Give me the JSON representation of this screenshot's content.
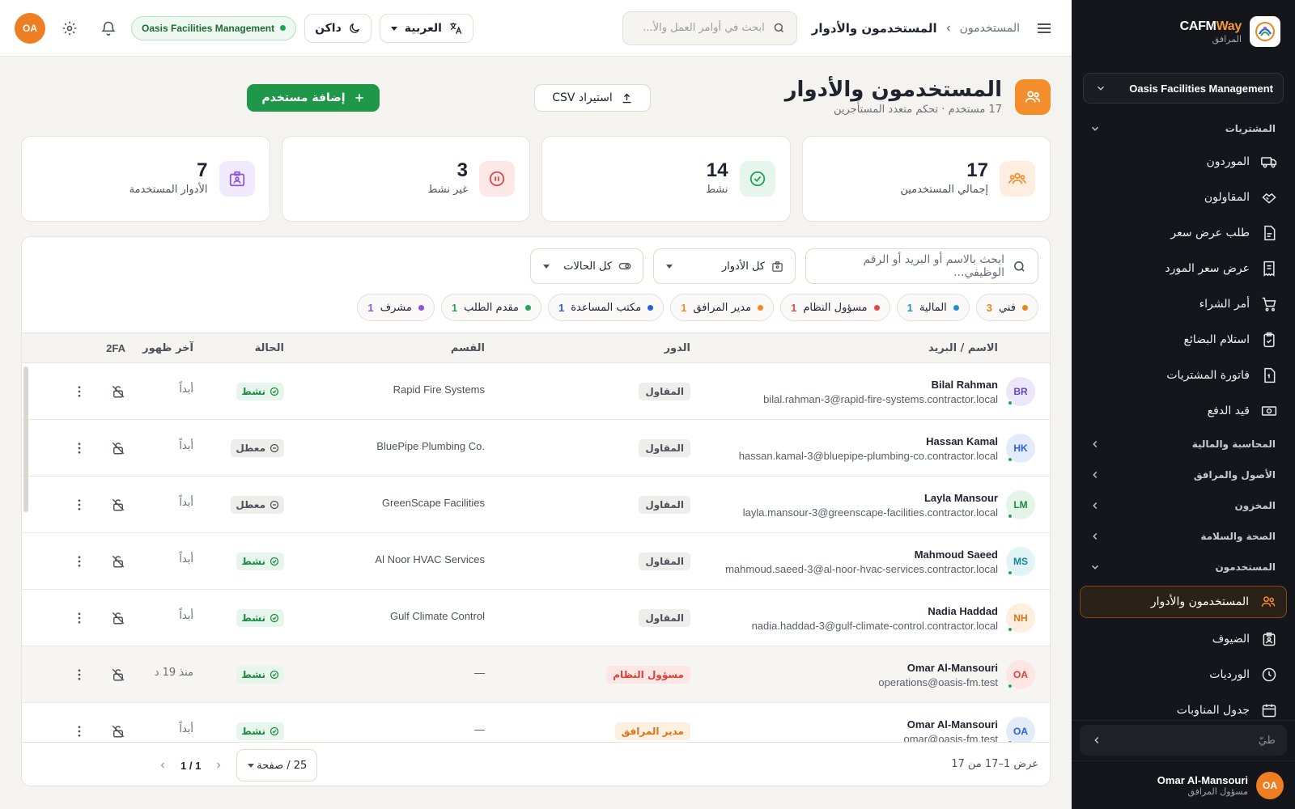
{
  "colors": {
    "accent": "#f48d2c",
    "primary_green": "#1f9748",
    "sidebar_bg": "#14161b"
  },
  "sidebar": {
    "brand_name_a": "CAFM",
    "brand_name_b": "Way",
    "brand_sub": "المرافق",
    "org": "Oasis Facilities Management",
    "groups": [
      {
        "label": "المشتريات",
        "expanded": true
      },
      {
        "label": "المحاسبة والمالية",
        "expanded": false
      },
      {
        "label": "الأصول والمرافق",
        "expanded": false
      },
      {
        "label": "المخزون",
        "expanded": false
      },
      {
        "label": "الصحة والسلامة",
        "expanded": false
      },
      {
        "label": "المستخدمون",
        "expanded": true
      }
    ],
    "procurement_items": [
      {
        "label": "الموردون",
        "icon": "truck-icon"
      },
      {
        "label": "المقاولون",
        "icon": "handshake-icon"
      },
      {
        "label": "طلب عرض سعر",
        "icon": "document-icon"
      },
      {
        "label": "عرض سعر المورد",
        "icon": "receipt-icon"
      },
      {
        "label": "أمر الشراء",
        "icon": "cart-icon"
      },
      {
        "label": "استلام البضائع",
        "icon": "clipboard-check-icon"
      },
      {
        "label": "فاتورة المشتريات",
        "icon": "invoice-icon"
      },
      {
        "label": "قيد الدفع",
        "icon": "cash-icon"
      }
    ],
    "users_items": [
      {
        "label": "المستخدمون والأدوار",
        "icon": "users-icon",
        "active": true
      },
      {
        "label": "الضيوف",
        "icon": "guest-badge-icon"
      },
      {
        "label": "الورديات",
        "icon": "clock-icon"
      },
      {
        "label": "جدول المناوبات",
        "icon": "calendar-icon"
      }
    ],
    "collapse_search": "طيّ",
    "user": {
      "initials": "OA",
      "name": "Omar Al-Mansouri",
      "role": "مسؤول المرافق"
    }
  },
  "topbar": {
    "breadcrumb_parent": "المستخدمون",
    "breadcrumb_current": "المستخدمون والأدوار",
    "search_placeholder": "ابحث في أوامر العمل والأ...",
    "language": "العربية",
    "theme": "داكن",
    "org": "Oasis Facilities Management",
    "user_initials": "OA"
  },
  "page": {
    "title": "المستخدمون والأدوار",
    "subtitle": "17 مستخدم · تحكم متعدد المستأجرين",
    "import_csv": "استيراد CSV",
    "add_user": "إضافة مستخدم"
  },
  "stats": [
    {
      "value": "17",
      "label": "إجمالي المستخدمين",
      "icon": "users-icon",
      "color": "#f48d2c",
      "bg": "#fdeee0"
    },
    {
      "value": "14",
      "label": "نشط",
      "icon": "check-circle-icon",
      "color": "#22a45a",
      "bg": "#e6f6ec"
    },
    {
      "value": "3",
      "label": "غير نشط",
      "icon": "pause-circle-icon",
      "color": "#e24848",
      "bg": "#fde8e8"
    },
    {
      "value": "7",
      "label": "الأدوار المستخدمة",
      "icon": "id-badge-icon",
      "color": "#8a55d6",
      "bg": "#f1e9fc"
    }
  ],
  "filters": {
    "search_placeholder": "ابحث بالاسم أو البريد أو الرقم الوظيفي...",
    "roles": "كل الأدوار",
    "statuses": "كل الحالات"
  },
  "role_chips": [
    {
      "label": "فني",
      "count": "3",
      "color": "#e6861f"
    },
    {
      "label": "المالية",
      "count": "1",
      "color": "#1f8fd1"
    },
    {
      "label": "مسؤول النظام",
      "count": "1",
      "color": "#e24848"
    },
    {
      "label": "مدير المرافق",
      "count": "1",
      "color": "#ef8a24"
    },
    {
      "label": "مكتب المساعدة",
      "count": "1",
      "color": "#2c5fd6"
    },
    {
      "label": "مقدم الطلب",
      "count": "1",
      "color": "#22a45a"
    },
    {
      "label": "مشرف",
      "count": "1",
      "color": "#8a55d6"
    }
  ],
  "table": {
    "headers": {
      "name": "الاسم / البريد",
      "role": "الدور",
      "dept": "القسم",
      "status": "الحالة",
      "last_seen": "آخر ظهور",
      "tfa": "2FA"
    },
    "rows": [
      {
        "initials": "BR",
        "name": "Bilal Rahman",
        "email": "bilal.rahman-3@rapid-fire-systems.contractor.local",
        "role": "المقاول",
        "role_type": "contractor",
        "dept": "Rapid Fire Systems",
        "status": "نشط",
        "status_type": "active",
        "last_seen": "أبداً",
        "av_bg": "#ece6fb",
        "av_fg": "#6b46c1"
      },
      {
        "initials": "HK",
        "name": "Hassan Kamal",
        "email": "hassan.kamal-3@bluepipe-plumbing-co.contractor.local",
        "role": "المقاول",
        "role_type": "contractor",
        "dept": "BluePipe Plumbing Co.",
        "status": "معطل",
        "status_type": "disabled",
        "last_seen": "أبداً",
        "av_bg": "#e3ebfa",
        "av_fg": "#2c5fd6"
      },
      {
        "initials": "LM",
        "name": "Layla Mansour",
        "email": "layla.mansour-3@greenscape-facilities.contractor.local",
        "role": "المقاول",
        "role_type": "contractor",
        "dept": "GreenScape Facilities",
        "status": "معطل",
        "status_type": "disabled",
        "last_seen": "أبداً",
        "av_bg": "#e3f4e8",
        "av_fg": "#1f8a44"
      },
      {
        "initials": "MS",
        "name": "Mahmoud Saeed",
        "email": "mahmoud.saeed-3@al-noor-hvac-services.contractor.local",
        "role": "المقاول",
        "role_type": "contractor",
        "dept": "Al Noor HVAC Services",
        "status": "نشط",
        "status_type": "active",
        "last_seen": "أبداً",
        "av_bg": "#e0f4f6",
        "av_fg": "#14879a"
      },
      {
        "initials": "NH",
        "name": "Nadia Haddad",
        "email": "nadia.haddad-3@gulf-climate-control.contractor.local",
        "role": "المقاول",
        "role_type": "contractor",
        "dept": "Gulf Climate Control",
        "status": "نشط",
        "status_type": "active",
        "last_seen": "أبداً",
        "av_bg": "#fdeedd",
        "av_fg": "#d9731c"
      },
      {
        "initials": "OA",
        "name": "Omar Al-Mansouri",
        "email": "operations@oasis-fm.test",
        "role": "مسؤول النظام",
        "role_type": "admin",
        "dept": "—",
        "status": "نشط",
        "status_type": "active",
        "last_seen": "منذ 19 د",
        "av_bg": "#fde5e3",
        "av_fg": "#d8433a",
        "highlight": true
      },
      {
        "initials": "OA",
        "name": "Omar Al-Mansouri",
        "email": "omar@oasis-fm.test",
        "role": "مدير المرافق",
        "role_type": "manager",
        "dept": "—",
        "status": "نشط",
        "status_type": "active",
        "last_seen": "أبداً",
        "av_bg": "#e3ebfa",
        "av_fg": "#2c5fd6"
      }
    ]
  },
  "footer": {
    "range": "عرض 1–17 من 17",
    "per_page": "25 / صفحة",
    "page": "1 / 1"
  }
}
